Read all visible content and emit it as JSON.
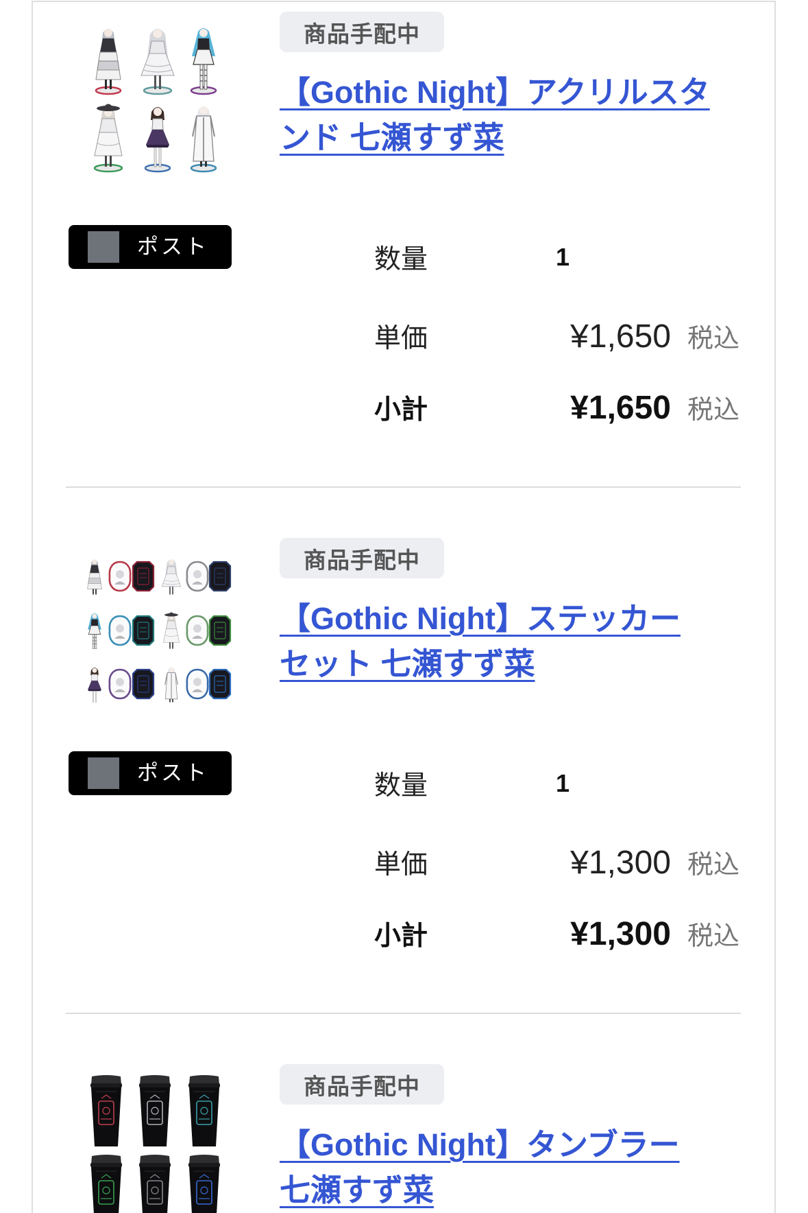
{
  "items": [
    {
      "status": "商品手配中",
      "title_lines": [
        "【Gothic Night】アクリルスタ",
        "ンド 七瀬すず菜"
      ],
      "shipping": "ポスト",
      "quantity": {
        "label": "数量",
        "value": "1"
      },
      "unit_price": {
        "label": "単価",
        "value": "¥1,650",
        "tax": "税込"
      },
      "subtotal": {
        "label": "小計",
        "value": "¥1,650",
        "tax": "税込"
      }
    },
    {
      "status": "商品手配中",
      "title_lines": [
        "【Gothic Night】ステッカー",
        "セット 七瀬すず菜"
      ],
      "shipping": "ポスト",
      "quantity": {
        "label": "数量",
        "value": "1"
      },
      "unit_price": {
        "label": "単価",
        "value": "¥1,300",
        "tax": "税込"
      },
      "subtotal": {
        "label": "小計",
        "value": "¥1,300",
        "tax": "税込"
      }
    },
    {
      "status": "商品手配中",
      "title_lines": [
        "【Gothic Night】タンブラー",
        "七瀬すず菜"
      ]
    }
  ],
  "colors": {
    "link": "#3556d3",
    "badge_bg": "#eceef2",
    "badge_text": "#555555",
    "tax_text": "#777777",
    "shipping_badge_bg": "#000000",
    "shipping_icon": "#6e737a",
    "divider": "#dcdcdc",
    "card_border": "#dedede"
  }
}
